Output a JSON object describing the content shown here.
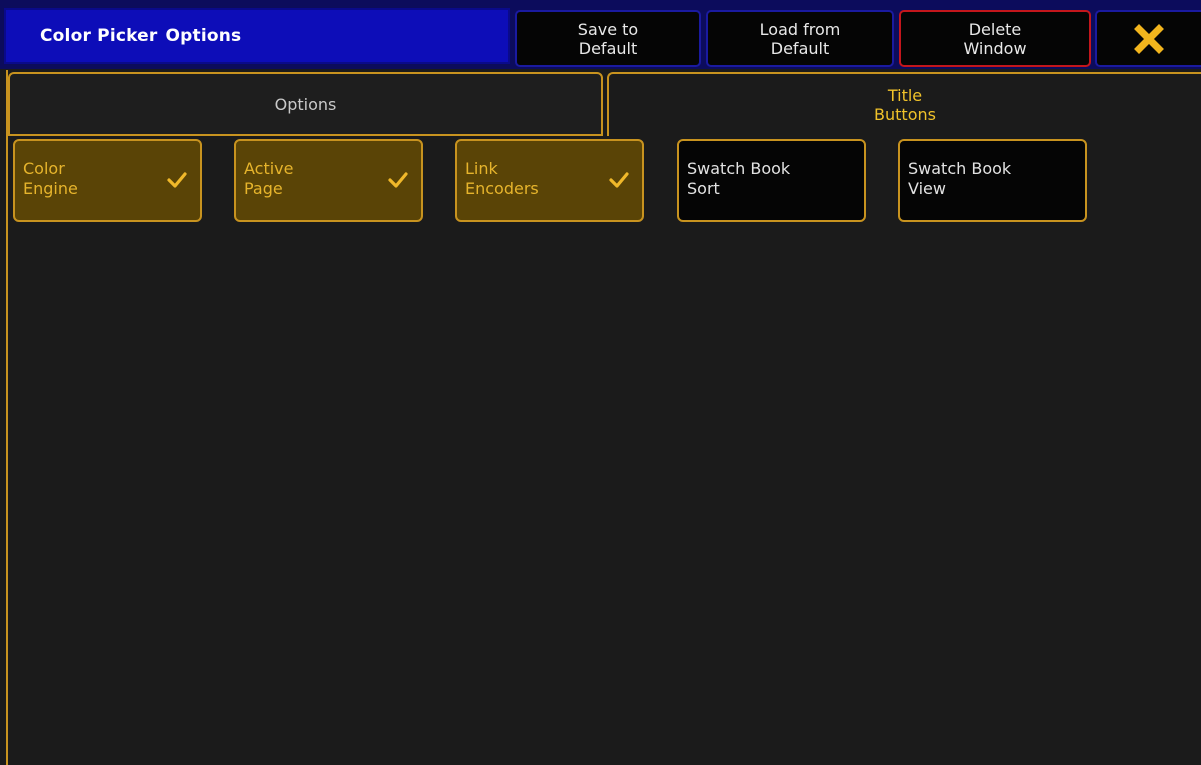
{
  "window": {
    "title_part1": "Color Picker",
    "title_part2": "Options"
  },
  "titlebar_buttons": {
    "save_line1": "Save to",
    "save_line2": "Default",
    "load_line1": "Load from",
    "load_line2": "Default",
    "delete_line1": "Delete",
    "delete_line2": "Window",
    "close_icon": "close-x-icon"
  },
  "tabs": {
    "options_label": "Options",
    "title_buttons_line1": "Title",
    "title_buttons_line2": "Buttons",
    "active": "title_buttons"
  },
  "buttons": [
    {
      "label": "Color\nEngine",
      "checked": true
    },
    {
      "label": "Active\nPage",
      "checked": true
    },
    {
      "label": "Link\nEncoders",
      "checked": true
    },
    {
      "label": "Swatch Book\nSort",
      "checked": false
    },
    {
      "label": "Swatch Book\nView",
      "checked": false
    }
  ],
  "colors": {
    "accent": "#c8931f",
    "accent_text": "#f0c22a",
    "checked_bg": "#5a4406",
    "title_bg": "#0d0db8",
    "delete_border": "#c4161c",
    "close_icon": "#f2b51d"
  }
}
